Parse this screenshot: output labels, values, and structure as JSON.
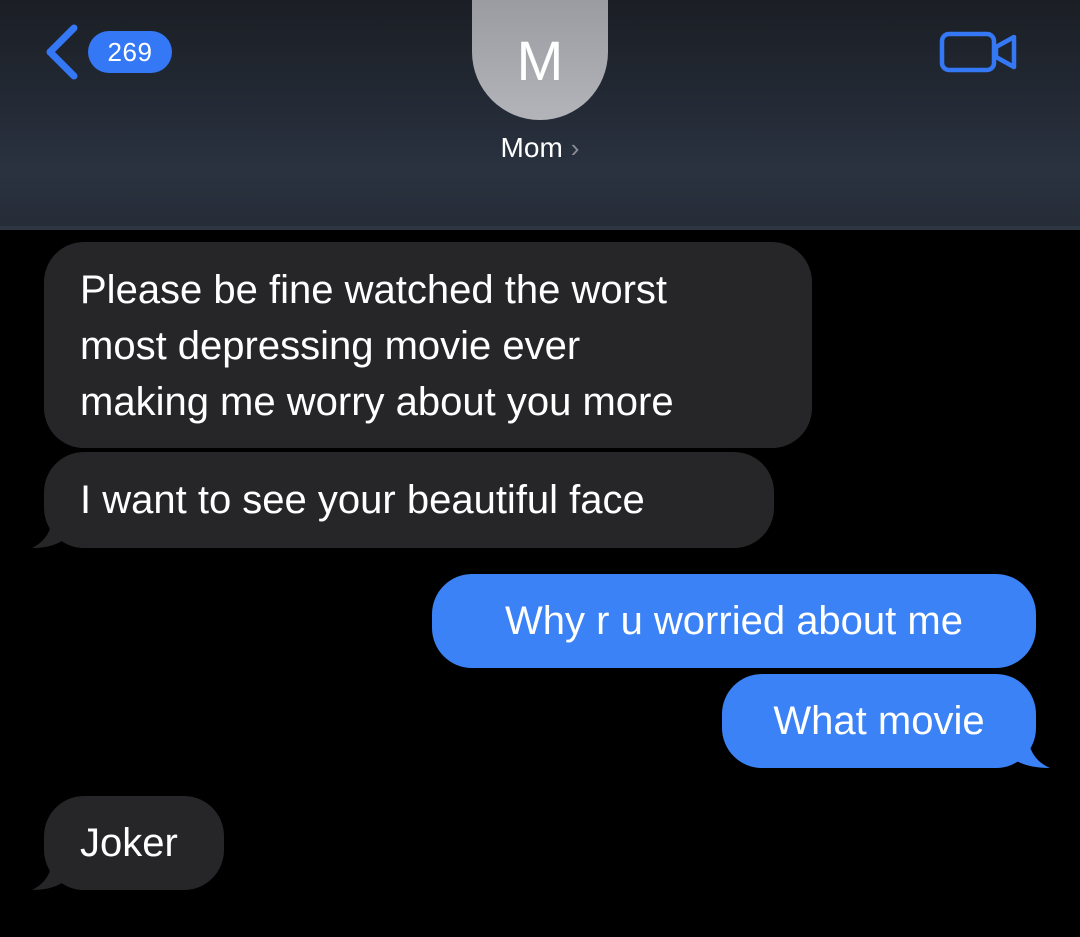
{
  "header": {
    "unread_count": "269",
    "avatar_initial": "M",
    "contact_name": "Mom",
    "contact_chevron": "›",
    "icons": {
      "back": "chevron-left-icon",
      "video": "video-camera-icon"
    }
  },
  "messages": [
    {
      "direction": "incoming",
      "text": "Please be fine watched the worst most depressing movie ever making me worry about you more",
      "lines": [
        "Please be fine watched the worst",
        "most depressing movie ever",
        "making me worry about you more"
      ]
    },
    {
      "direction": "incoming",
      "text": "I want to see your beautiful face"
    },
    {
      "direction": "outgoing",
      "text": "Why r u worried about me"
    },
    {
      "direction": "outgoing",
      "text": "What movie"
    },
    {
      "direction": "incoming",
      "text": "Joker"
    }
  ],
  "colors": {
    "accent": "#3478f6",
    "outgoing_bubble": "#3b82f6",
    "incoming_bubble": "#262628",
    "background": "#000000"
  }
}
